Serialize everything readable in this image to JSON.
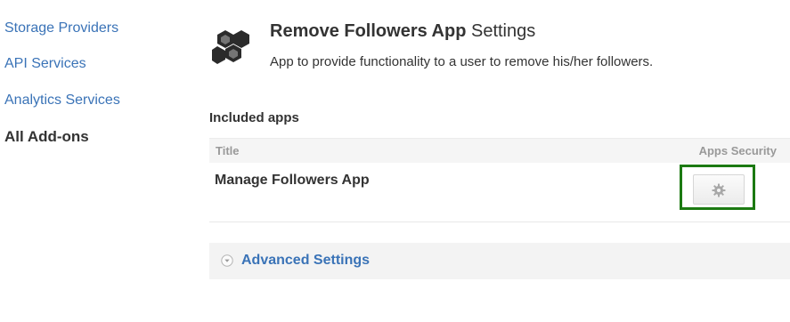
{
  "sidebar": {
    "items": [
      {
        "label": "Storage Providers",
        "active": false
      },
      {
        "label": "API Services",
        "active": false
      },
      {
        "label": "Analytics Services",
        "active": false
      },
      {
        "label": "All Add-ons",
        "active": true
      }
    ]
  },
  "app": {
    "name": "Remove Followers App",
    "title_suffix": "Settings",
    "description": "App to provide functionality to a user to remove his/her followers.",
    "logo_icon": "hexagon-cubes-icon"
  },
  "included_apps": {
    "heading": "Included apps",
    "columns": [
      "Title",
      "Apps Security"
    ],
    "rows": [
      {
        "title": "Manage Followers App",
        "security_icon": "gear-icon"
      }
    ]
  },
  "advanced_settings": {
    "label": "Advanced Settings",
    "icon": "chevron-down-circle-icon"
  },
  "colors": {
    "link": "#3a73b7",
    "highlight": "#1c7a12",
    "text": "#333333",
    "muted": "#999999"
  }
}
